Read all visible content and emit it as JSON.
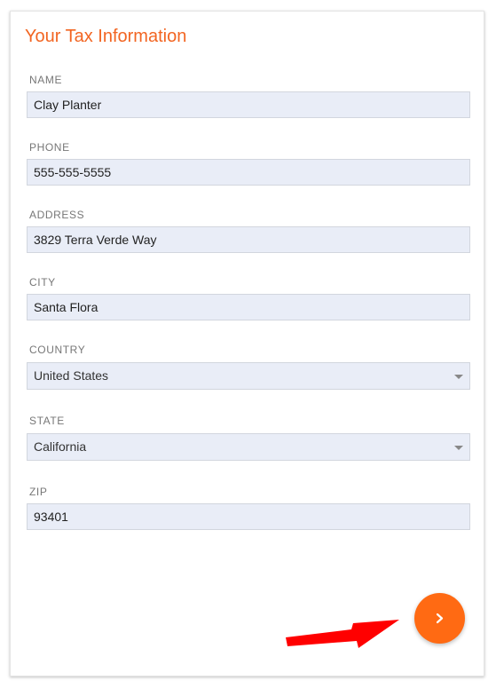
{
  "form": {
    "title": "Your Tax Information",
    "fields": {
      "name": {
        "label": "NAME",
        "value": "Clay Planter"
      },
      "phone": {
        "label": "PHONE",
        "value": "555-555-5555"
      },
      "address": {
        "label": "ADDRESS",
        "value": "3829 Terra Verde Way"
      },
      "city": {
        "label": "CITY",
        "value": "Santa Flora"
      },
      "country": {
        "label": "COUNTRY",
        "value": "United States"
      },
      "state": {
        "label": "STATE",
        "value": "California"
      },
      "zip": {
        "label": "ZIP",
        "value": "93401"
      }
    }
  },
  "actions": {
    "next_icon": "chevron-right-icon",
    "next_color": "#ff6a13"
  },
  "annotation": {
    "icon": "red-arrow-icon",
    "color": "#ff0000"
  },
  "colors": {
    "title": "#f26522",
    "field_background": "#e9edf7"
  }
}
